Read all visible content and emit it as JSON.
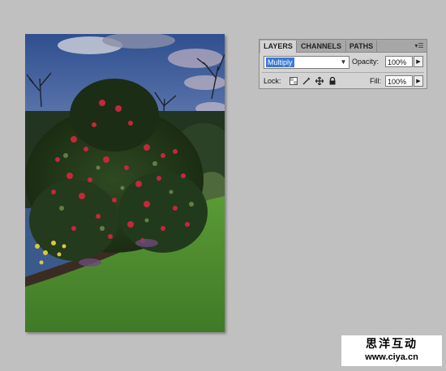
{
  "document": {
    "image": "garden-photo-rhododendron-bush-lawn-sky"
  },
  "layers_panel": {
    "tabs": [
      {
        "label": "LAYERS",
        "active": true
      },
      {
        "label": "CHANNELS",
        "active": false
      },
      {
        "label": "PATHS",
        "active": false
      }
    ],
    "menu_icon": "panel-menu-icon",
    "blend_mode": "Multiply",
    "opacity_label": "Opacity:",
    "opacity_value": "100%",
    "lock_label": "Lock:",
    "lock_icons": [
      "lock-transparent-pixels-icon",
      "lock-image-pixels-icon",
      "lock-position-icon",
      "lock-all-icon"
    ],
    "fill_label": "Fill:",
    "fill_value": "100%"
  },
  "watermark": {
    "title": "思洋互动",
    "url": "www.ciya.cn"
  },
  "colors": {
    "background": "#c0c0c0",
    "panel": "#d4d4d4",
    "selection": "#3c78d8"
  }
}
